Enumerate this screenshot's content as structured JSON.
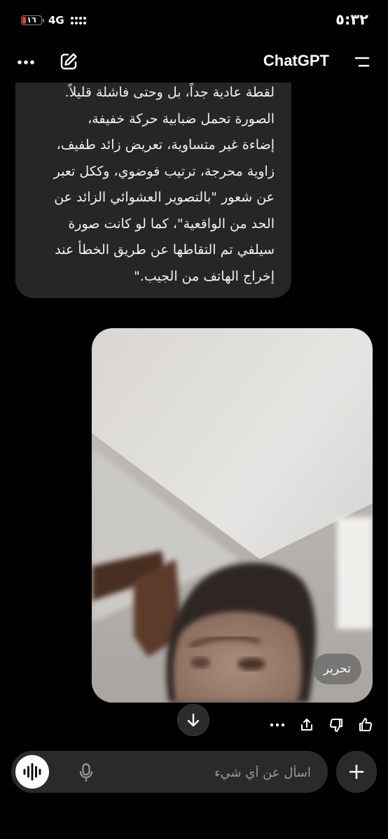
{
  "status_bar": {
    "battery_level": "١٦",
    "network": "4G",
    "time": "٥:٣٢"
  },
  "header": {
    "title": "ChatGPT"
  },
  "assistant_message": {
    "text": "لقطة عادية جداً، بل وحتى فاشلة قليلاً.\nالصورة تحمل ضبابية حركة خفيفة،\nإضاءة غير متساوية، تعريض زائد طفيف،\nزاوية محرجة، ترتيب فوضوي، وككل تعبر\nعن شعور \"بالتصوير العشوائي الزائد عن\nالحد من الواقعية\"، كما لو كانت صورة\nسيلفي تم التقاطها عن طريق الخطأ عند\nإخراج الهاتف من الجيب.\""
  },
  "user_image": {
    "edit_label": "تحرير"
  },
  "composer": {
    "placeholder": "اسأل عن أي شيء"
  },
  "icons": {
    "more": "more-icon",
    "edit": "new-chat-icon",
    "menu": "menu-icon",
    "scroll": "arrow-down-icon",
    "thumbs_up": "thumbs-up-icon",
    "thumbs_down": "thumbs-down-icon",
    "share": "share-icon",
    "voice": "voice-wave-icon",
    "mic": "mic-icon",
    "plus": "plus-icon"
  }
}
